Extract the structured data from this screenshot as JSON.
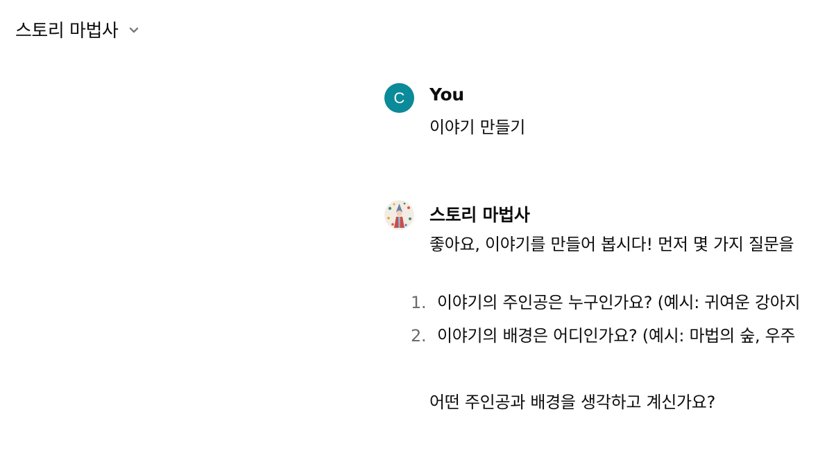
{
  "header": {
    "title": "스토리 마법사",
    "chevron_icon": "chevron-down-icon"
  },
  "messages": {
    "user": {
      "avatar_letter": "C",
      "avatar_color": "#0b8a99",
      "author": "You",
      "text": "이야기 만들기"
    },
    "assistant": {
      "avatar_icon": "wizard-avatar-icon",
      "author": "스토리 마법사",
      "intro": "좋아요, 이야기를 만들어 봅시다! 먼저 몇 가지 질문을",
      "list": [
        {
          "number": "1.",
          "text": "이야기의 주인공은 누구인가요? (예시: 귀여운 강아지"
        },
        {
          "number": "2.",
          "text": "이야기의 배경은 어디인가요? (예시: 마법의 숲, 우주"
        }
      ],
      "closing": "어떤 주인공과 배경을 생각하고 계신가요?"
    }
  }
}
